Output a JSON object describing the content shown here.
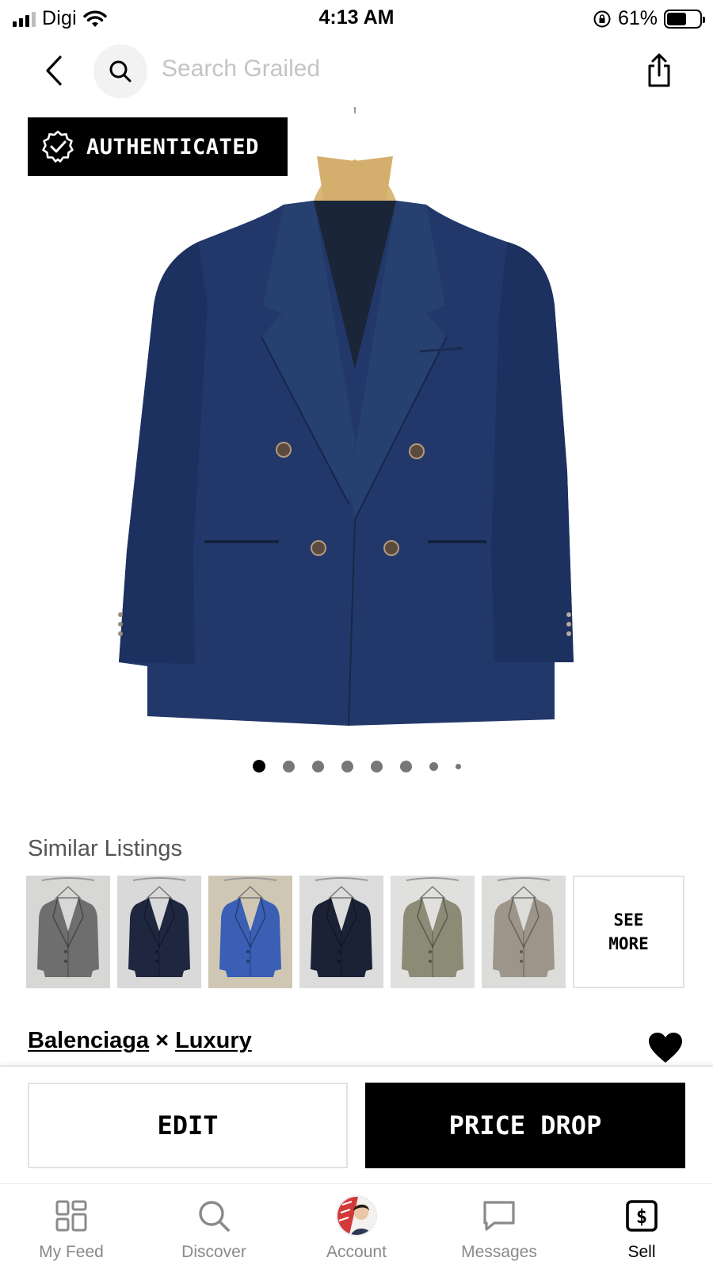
{
  "status_bar": {
    "carrier": "Digi",
    "time": "4:13 AM",
    "battery": "61%",
    "battery_level": 0.61
  },
  "nav": {
    "search_placeholder": "Search Grailed"
  },
  "product": {
    "badge": "AUTHENTICATED",
    "image_icon": "navy-double-breasted-blazer",
    "photo_count": 8,
    "current_photo": 1
  },
  "similar": {
    "title": "Similar Listings",
    "thumbnails": [
      {
        "icon": "grey-blazer",
        "color": "#6e6e6e",
        "bg": "#d7d7d5"
      },
      {
        "icon": "navy-blazer",
        "color": "#1f2740",
        "bg": "#d9d9d9"
      },
      {
        "icon": "blue-check-blazer",
        "color": "#3a5fb5",
        "bg": "#cfc7b4"
      },
      {
        "icon": "dark-navy-blazer",
        "color": "#1c2236",
        "bg": "#dcdcdc"
      },
      {
        "icon": "olive-blazer",
        "color": "#8c8b76",
        "bg": "#e0e0de"
      },
      {
        "icon": "taupe-blazer",
        "color": "#9d958a",
        "bg": "#dcdcda"
      }
    ],
    "see_more": "SEE\nMORE"
  },
  "brand": {
    "designer_1": "Balenciaga",
    "separator": "×",
    "designer_2": "Luxury"
  },
  "actions": {
    "edit": "EDIT",
    "price_drop": "PRICE DROP"
  },
  "tabs": [
    {
      "label": "My Feed",
      "icon": "grid-icon"
    },
    {
      "label": "Discover",
      "icon": "search-icon"
    },
    {
      "label": "Account",
      "icon": "avatar"
    },
    {
      "label": "Messages",
      "icon": "chat-icon"
    },
    {
      "label": "Sell",
      "icon": "dollar-tag-icon",
      "active": true
    }
  ],
  "colors": {
    "accent": "#000000",
    "jacket": "#213a6b",
    "placeholder": "#c4c4c4"
  }
}
